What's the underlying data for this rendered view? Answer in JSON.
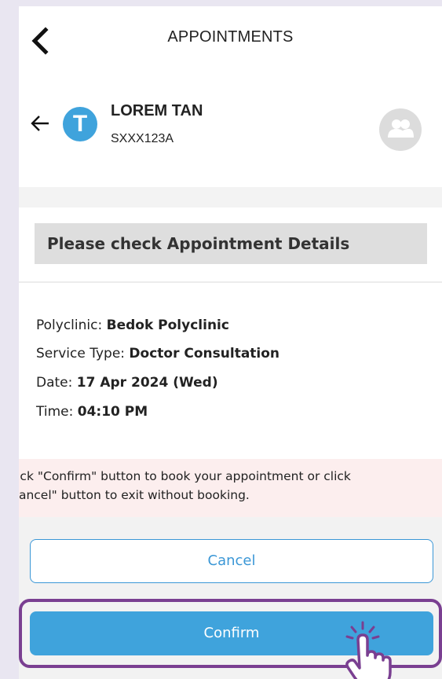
{
  "header": {
    "title": "APPOINTMENTS",
    "back_icon": "chevron-left-icon"
  },
  "patient": {
    "back_icon": "arrow-left-icon",
    "avatar_initial": "T",
    "name": "LOREM TAN",
    "id": "SXXX123A",
    "family_icon": "family-members-icon",
    "avatar_color": "#3fa3dc"
  },
  "details": {
    "heading": "Please check Appointment Details",
    "rows": [
      {
        "label": "Polyclinic:",
        "value": "Bedok Polyclinic"
      },
      {
        "label": "Service Type:",
        "value": "Doctor Consultation"
      },
      {
        "label": "Date:",
        "value": "17 Apr 2024 (Wed)"
      },
      {
        "label": "Time:",
        "value": "04:10 PM"
      }
    ]
  },
  "notice": {
    "line1": "Click \"Confirm\" button to book your appointment or click",
    "line2": "\"Cancel\" button to exit without booking."
  },
  "actions": {
    "cancel_label": "Cancel",
    "confirm_label": "Confirm",
    "accent_color": "#3b97d6",
    "highlight_color": "#7a3f91",
    "pointer_icon": "hand-pointer-icon"
  }
}
